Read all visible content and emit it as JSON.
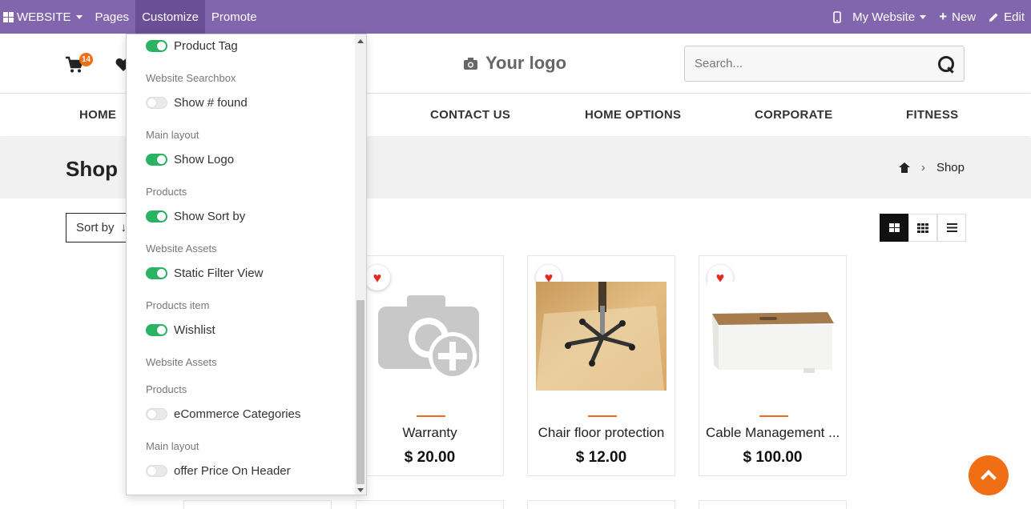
{
  "topbar": {
    "website_label": "WEBSITE",
    "pages_label": "Pages",
    "customize_label": "Customize",
    "promote_label": "Promote",
    "my_website_label": "My Website",
    "new_label": "New",
    "edit_label": "Edit",
    "color": "#8166ad"
  },
  "header": {
    "cart_count": "14",
    "logo_text": "Your logo",
    "search_placeholder": "Search..."
  },
  "nav": {
    "items": [
      "HOME",
      "CONTACT US",
      "HOME OPTIONS",
      "CORPORATE",
      "FITNESS"
    ]
  },
  "page": {
    "title": "Shop",
    "breadcrumb": "Shop"
  },
  "toolbar": {
    "sort_label": "Sort by"
  },
  "products": [
    {
      "name": "Warranty",
      "price": "$ 20.00"
    },
    {
      "name": "Chair floor protection",
      "price": "$ 12.00"
    },
    {
      "name": "Cable Management ...",
      "price": "$ 100.00"
    }
  ],
  "customize_menu": {
    "items": [
      {
        "type": "option",
        "label": "Product Tag",
        "enabled": true
      },
      {
        "type": "section",
        "label": "Website Searchbox"
      },
      {
        "type": "option",
        "label": "Show # found",
        "enabled": false
      },
      {
        "type": "section",
        "label": "Main layout"
      },
      {
        "type": "option",
        "label": "Show Logo",
        "enabled": true
      },
      {
        "type": "section",
        "label": "Products"
      },
      {
        "type": "option",
        "label": "Show Sort by",
        "enabled": true
      },
      {
        "type": "section",
        "label": "Website Assets"
      },
      {
        "type": "option",
        "label": "Static Filter View",
        "enabled": true
      },
      {
        "type": "section",
        "label": "Products item"
      },
      {
        "type": "option",
        "label": "Wishlist",
        "enabled": true
      },
      {
        "type": "section",
        "label": "Website Assets"
      },
      {
        "type": "section",
        "label": "Products"
      },
      {
        "type": "option",
        "label": "eCommerce Categories",
        "enabled": false
      },
      {
        "type": "section",
        "label": "Main layout"
      },
      {
        "type": "option",
        "label": "offer Price On Header",
        "enabled": false
      }
    ]
  },
  "colors": {
    "accent": "#f06e14",
    "toggle_on": "#28b463"
  }
}
